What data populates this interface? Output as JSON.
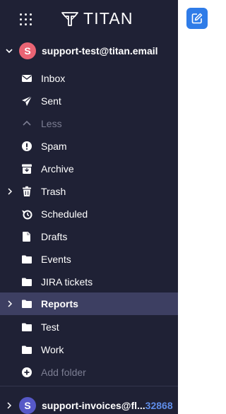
{
  "app": {
    "logo_text": "TITAN"
  },
  "accounts": [
    {
      "avatar_letter": "S",
      "avatar_color": "#ea6474",
      "email": "support-test@titan.email",
      "expanded": true
    },
    {
      "avatar_letter": "S",
      "avatar_color": "#5658c7",
      "email": "support-invoices@fl...",
      "count": "32868",
      "expanded": false
    }
  ],
  "folders": [
    {
      "label": "Inbox",
      "icon": "envelope-icon"
    },
    {
      "label": "Sent",
      "icon": "paper-plane-icon"
    },
    {
      "label": "Less",
      "icon": "chevron-up-icon"
    },
    {
      "label": "Spam",
      "icon": "alert-circle-icon"
    },
    {
      "label": "Archive",
      "icon": "archive-icon"
    },
    {
      "label": "Trash",
      "icon": "trash-icon"
    },
    {
      "label": "Scheduled",
      "icon": "clock-send-icon"
    },
    {
      "label": "Drafts",
      "icon": "draft-icon"
    },
    {
      "label": "Events",
      "icon": "folder-icon"
    },
    {
      "label": "JIRA tickets",
      "icon": "folder-icon"
    },
    {
      "label": "Reports",
      "icon": "folder-icon"
    },
    {
      "label": "Test",
      "icon": "folder-icon"
    },
    {
      "label": "Work",
      "icon": "folder-icon"
    },
    {
      "label": "Add folder",
      "icon": "plus-circle-icon"
    }
  ],
  "colors": {
    "sidebar_bg": "#1f2135",
    "active_row_bg": "#3d3f62",
    "compose_blue": "#2f7ce8",
    "muted_text": "#7c7e93",
    "count_text": "#5f8de8"
  }
}
